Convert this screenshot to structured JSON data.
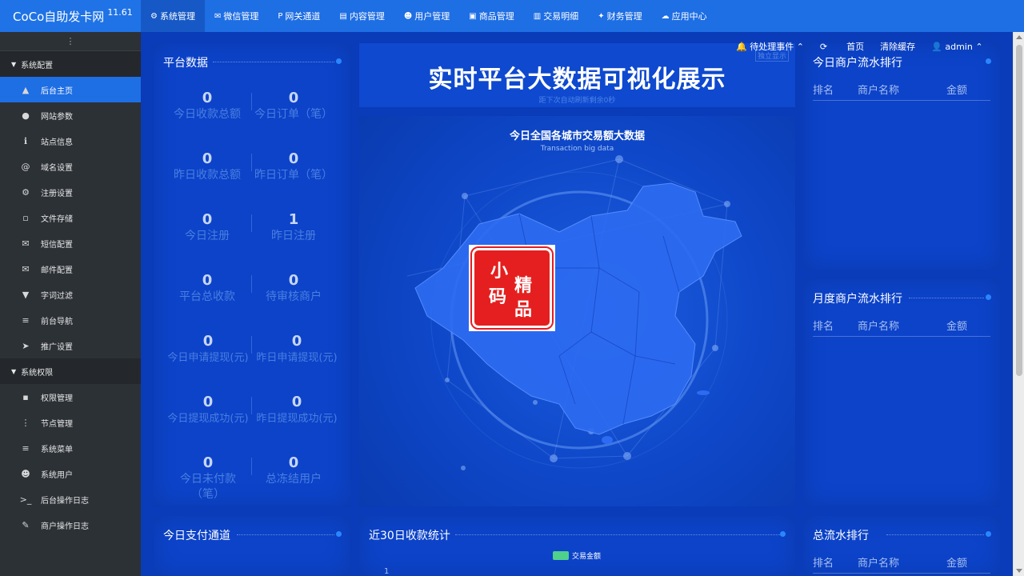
{
  "brand": {
    "name": "CoCo自助发卡网",
    "version": "11.61"
  },
  "topnav": [
    {
      "icon": "⚙",
      "label": "系统管理",
      "active": true
    },
    {
      "icon": "✉",
      "label": "微信管理"
    },
    {
      "icon": "P",
      "label": "网关通道"
    },
    {
      "icon": "▤",
      "label": "内容管理"
    },
    {
      "icon": "☻",
      "label": "用户管理"
    },
    {
      "icon": "▣",
      "label": "商品管理"
    },
    {
      "icon": "▥",
      "label": "交易明细"
    },
    {
      "icon": "✦",
      "label": "财务管理"
    },
    {
      "icon": "☁",
      "label": "应用中心"
    }
  ],
  "utilbar": {
    "pending": "待处理事件",
    "home": "首页",
    "clear_cache": "清除缓存",
    "user": "admin"
  },
  "sidebar": {
    "toggle": "⋮",
    "group1": "系统配置",
    "items1": [
      {
        "icon": "▲",
        "label": "后台主页",
        "active": true
      },
      {
        "icon": "●",
        "label": "网站参数"
      },
      {
        "icon": "ℹ",
        "label": "站点信息"
      },
      {
        "icon": "@",
        "label": "域名设置"
      },
      {
        "icon": "⚙",
        "label": "注册设置"
      },
      {
        "icon": "▫",
        "label": "文件存储"
      },
      {
        "icon": "✉",
        "label": "短信配置"
      },
      {
        "icon": "✉",
        "label": "邮件配置"
      },
      {
        "icon": "▼",
        "label": "字词过滤"
      },
      {
        "icon": "≡",
        "label": "前台导航"
      },
      {
        "icon": "➤",
        "label": "推广设置"
      }
    ],
    "group2": "系统权限",
    "items2": [
      {
        "icon": "▪",
        "label": "权限管理"
      },
      {
        "icon": "⋮",
        "label": "节点管理"
      },
      {
        "icon": "≡",
        "label": "系统菜单"
      },
      {
        "icon": "☻",
        "label": "系统用户"
      },
      {
        "icon": ">_",
        "label": "后台操作日志"
      },
      {
        "icon": "✎",
        "label": "商户操作日志"
      }
    ]
  },
  "platform": {
    "title": "平台数据",
    "stats": [
      {
        "value": "0",
        "label": "今日收款总额"
      },
      {
        "value": "0",
        "label": "今日订单（笔）"
      },
      {
        "value": "0",
        "label": "昨日收款总额"
      },
      {
        "value": "0",
        "label": "昨日订单（笔）"
      },
      {
        "value": "0",
        "label": "今日注册"
      },
      {
        "value": "1",
        "label": "昨日注册"
      },
      {
        "value": "0",
        "label": "平台总收款"
      },
      {
        "value": "0",
        "label": "待审核商户"
      },
      {
        "value": "0",
        "label": "今日申请提现(元)"
      },
      {
        "value": "0",
        "label": "昨日申请提现(元)"
      },
      {
        "value": "0",
        "label": "今日提现成功(元)"
      },
      {
        "value": "0",
        "label": "昨日提现成功(元)"
      },
      {
        "value": "0",
        "label": "今日未付款（笔）"
      },
      {
        "value": "0",
        "label": "总冻结用户"
      }
    ]
  },
  "headline": {
    "title": "实时平台大数据可视化展示",
    "subtitle": "距下次自动刷新剩余0秒",
    "tag": "独立显示"
  },
  "map": {
    "title": "今日全国各城市交易额大数据",
    "subtitle": "Transaction big data"
  },
  "seal": {
    "chars": [
      "小",
      "精",
      "码",
      "品"
    ]
  },
  "ranking": {
    "today": "今日商户流水排行",
    "month": "月度商户流水排行",
    "total": "总流水排行",
    "headers": [
      "排名",
      "商户名称",
      "金额"
    ]
  },
  "bottom": {
    "pay_channel": "今日支付通道",
    "stats30": "近30日收款统计",
    "legend": "交易金额",
    "y_tick": "1"
  },
  "colors": {
    "header": "#1e6ee4",
    "sidebar": "#2c3136",
    "panel": "#0c43c9",
    "accent": "#1e6ee4",
    "legend": "#4fd08c"
  }
}
